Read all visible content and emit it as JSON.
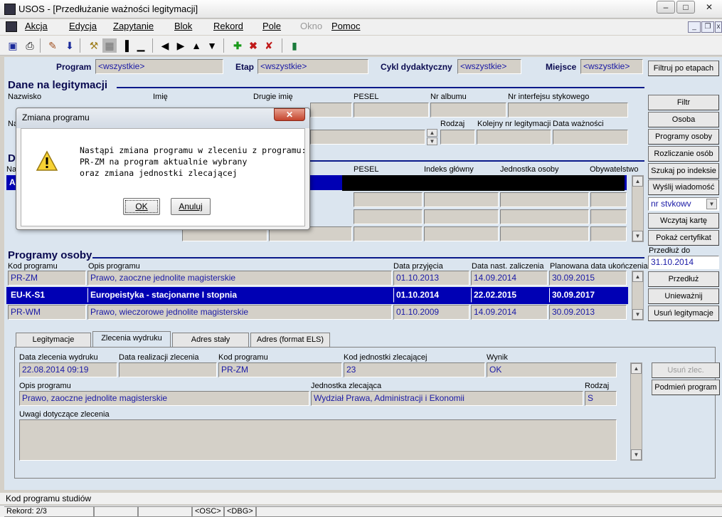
{
  "window": {
    "title": "USOS - [Przedłużanie ważności legitymacji]"
  },
  "menu": [
    {
      "label": "Akcja"
    },
    {
      "label": "Edycja"
    },
    {
      "label": "Zapytanie"
    },
    {
      "label": "Blok"
    },
    {
      "label": "Rekord"
    },
    {
      "label": "Pole"
    },
    {
      "label": "Okno",
      "disabled": true
    },
    {
      "label": "Pomoc"
    }
  ],
  "filters": {
    "program_label": "Program",
    "program_value": "<wszystkie>",
    "etap_label": "Etap",
    "etap_value": "<wszystkie>",
    "cykl_label": "Cykl dydaktyczny",
    "cykl_value": "<wszystkie>",
    "miejsce_label": "Miejsce",
    "miejsce_value": "<wszystkie>",
    "filter_button": "Filtruj po etapach"
  },
  "dane": {
    "title": "Dane na legitymacji",
    "nazwisko": "Nazwisko",
    "imie": "Imię",
    "drugie_imie": "Drugie imię",
    "pesel": "PESEL",
    "nr_albumu": "Nr albumu",
    "nr_interfejsu": "Nr interfejsu stykowego",
    "rodzaj": "Rodzaj",
    "kolejny_nr": "Kolejny nr legitymacji",
    "data_waznosci": "Data ważności"
  },
  "osoby": {
    "title_initial": "D",
    "col_first": "Na",
    "pesel": "PESEL",
    "indeks": "Indeks główny",
    "jednostka": "Jednostka osoby",
    "obywatelstwo": "Obywatelstwo",
    "sel_initial": "A"
  },
  "right_buttons": [
    "Filtr",
    "Osoba",
    "Programy osoby",
    "Rozliczanie osób",
    "Szukaj po indeksie",
    "Wyślij wiadomość"
  ],
  "combo": {
    "value": "nr stvkowv"
  },
  "right_buttons2": [
    "Wczytaj kartę",
    "Pokaż certyfikat"
  ],
  "przedluz": {
    "label": "Przedłuż do",
    "value": "31.10.2014"
  },
  "right_buttons3": [
    "Przedłuż",
    "Unieważnij",
    "Usuń legitymacje"
  ],
  "programy": {
    "title": "Programy osoby",
    "headers": {
      "kod": "Kod programu",
      "opis": "Opis programu",
      "data_przyjecia": "Data przyjęcia",
      "data_zal": "Data nast. zaliczenia",
      "planowana": "Planowana data ukończenia"
    },
    "rows": [
      {
        "kod": "PR-ZM",
        "opis": "Prawo, zaoczne jednolite magisterskie",
        "data_przyjecia": "01.10.2013",
        "data_zal": "14.09.2014",
        "planowana": "30.09.2015"
      },
      {
        "kod": "EU-K-S1",
        "opis": "Europeistyka - stacjonarne I stopnia",
        "data_przyjecia": "01.10.2014",
        "data_zal": "22.02.2015",
        "planowana": "30.09.2017",
        "selected": true
      },
      {
        "kod": "PR-WM",
        "opis": "Prawo, wieczorowe jednolite magisterskie",
        "data_przyjecia": "01.10.2009",
        "data_zal": "14.09.2014",
        "planowana": "30.09.2013"
      }
    ]
  },
  "tabs": [
    "Legitymacje",
    "Zlecenia wydruku",
    "Adres stały",
    "Adres (format ELS)"
  ],
  "zlecenia": {
    "data_zlecenia_label": "Data zlecenia wydruku",
    "data_zlecenia": "22.08.2014 09:19",
    "data_realizacji_label": "Data realizacji zlecenia",
    "data_realizacji": "",
    "kod_label": "Kod programu",
    "kod": "PR-ZM",
    "kod_jedn_label": "Kod jednostki zlecającej",
    "kod_jedn": "23",
    "wynik_label": "Wynik",
    "wynik": "OK",
    "opis_label": "Opis programu",
    "opis": "Prawo, zaoczne jednolite magisterskie",
    "jednostka_label": "Jednostka zlecająca",
    "jednostka": "Wydział Prawa, Administracji i Ekonomii",
    "rodzaj_label": "Rodzaj",
    "rodzaj": "S",
    "uwagi_label": "Uwagi dotyczące zlecenia",
    "usun_button": "Usuń zlec.",
    "podmien_button": "Podmień program"
  },
  "status": {
    "hint": "Kod programu studiów",
    "rekord": "Rekord: 2/3",
    "osc": "<OSC>",
    "dbg": "<DBG>"
  },
  "dialog": {
    "title": "Zmiana programu",
    "line1": "Nastąpi zmiana programu w zleceniu z programu:",
    "line2": "PR-ZM na program aktualnie wybrany",
    "line3": "oraz zmiana jednostki zlecającej",
    "ok": "OK",
    "cancel": "Anuluj"
  }
}
